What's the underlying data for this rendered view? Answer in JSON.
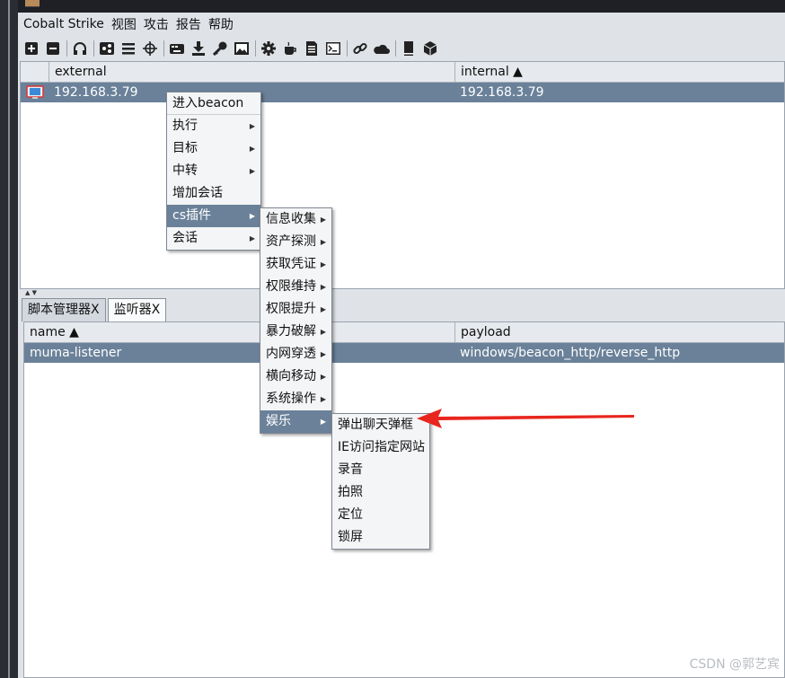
{
  "menubar": [
    "Cobalt Strike",
    "视图",
    "攻击",
    "报告",
    "帮助"
  ],
  "toolbar_icons": [
    "plus-icon",
    "minus-icon",
    "headphones-icon",
    "share-icon",
    "list-icon",
    "crosshair-icon",
    "keyboard-icon",
    "download-icon",
    "key-icon",
    "image-icon",
    "gear-icon",
    "coffee-icon",
    "document-icon",
    "terminal-icon",
    "link-icon",
    "cloud-icon",
    "book-icon",
    "package-icon"
  ],
  "sessions": {
    "columns": [
      "external",
      "internal ▲"
    ],
    "rows": [
      {
        "external": "192.168.3.79",
        "internal": "192.168.3.79"
      }
    ]
  },
  "tabs": [
    "脚本管理器X",
    "监听器X"
  ],
  "listeners": {
    "columns": [
      "name ▲",
      "payload"
    ],
    "rows": [
      {
        "name": "muma-listener",
        "payload": "windows/beacon_http/reverse_http"
      }
    ]
  },
  "context_menu": [
    "进入beacon",
    "执行",
    "目标",
    "中转",
    "增加会话",
    "cs插件",
    "会话"
  ],
  "plugin_menu": [
    "信息收集",
    "资产探测",
    "获取凭证",
    "权限维持",
    "权限提升",
    "暴力破解",
    "内网穿透",
    "横向移动",
    "系统操作",
    "娱乐"
  ],
  "fun_menu": [
    "弹出聊天弹框",
    "IE访问指定网站",
    "录音",
    "拍照",
    "定位",
    "锁屏"
  ],
  "watermark": "CSDN @郭艺宾",
  "colors": {
    "selection": "#6a8199",
    "arrow": "#e8261e"
  }
}
